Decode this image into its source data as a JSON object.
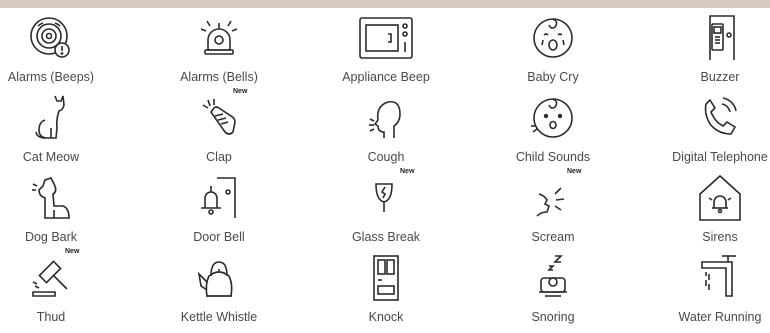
{
  "sounds": [
    {
      "label": "Alarms (Beeps)",
      "icon": "smoke-alarm-icon",
      "badge": ""
    },
    {
      "label": "Alarms (Bells)",
      "icon": "bell-alarm-icon",
      "badge": ""
    },
    {
      "label": "Appliance Beep",
      "icon": "microwave-icon",
      "badge": ""
    },
    {
      "label": "Baby Cry",
      "icon": "baby-cry-icon",
      "badge": ""
    },
    {
      "label": "Buzzer",
      "icon": "buzzer-icon",
      "badge": ""
    },
    {
      "label": "Cat Meow",
      "icon": "cat-icon",
      "badge": ""
    },
    {
      "label": "Clap",
      "icon": "clap-icon",
      "badge": "New"
    },
    {
      "label": "Cough",
      "icon": "cough-icon",
      "badge": ""
    },
    {
      "label": "Child Sounds",
      "icon": "child-icon",
      "badge": ""
    },
    {
      "label": "Digital Telephone",
      "icon": "telephone-icon",
      "badge": ""
    },
    {
      "label": "Dog Bark",
      "icon": "dog-icon",
      "badge": ""
    },
    {
      "label": "Door Bell",
      "icon": "doorbell-icon",
      "badge": ""
    },
    {
      "label": "Glass Break",
      "icon": "glass-icon",
      "badge": "New"
    },
    {
      "label": "Scream",
      "icon": "scream-icon",
      "badge": "New"
    },
    {
      "label": "Sirens",
      "icon": "siren-icon",
      "badge": ""
    },
    {
      "label": "Thud",
      "icon": "gavel-icon",
      "badge": "New"
    },
    {
      "label": "Kettle Whistle",
      "icon": "kettle-icon",
      "badge": ""
    },
    {
      "label": "Knock",
      "icon": "door-icon",
      "badge": ""
    },
    {
      "label": "Snoring",
      "icon": "snoring-icon",
      "badge": ""
    },
    {
      "label": "Water Running",
      "icon": "faucet-icon",
      "badge": ""
    }
  ],
  "colors": {
    "stroke": "#2b2b2b",
    "label": "#4a4a4a",
    "topband": "#d6cbc3"
  }
}
